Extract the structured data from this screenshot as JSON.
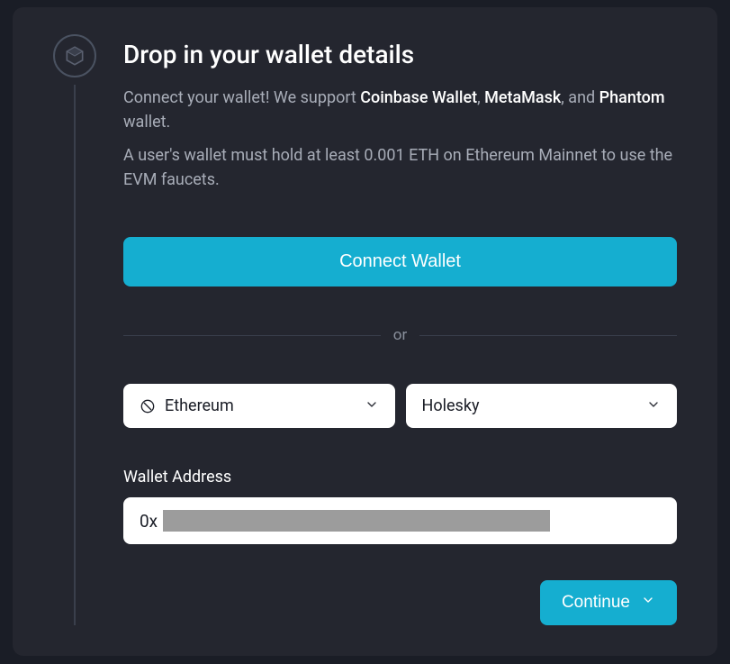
{
  "heading": "Drop in your wallet details",
  "description": {
    "intro": "Connect your wallet! We support ",
    "wallet1": "Coinbase Wallet",
    "sep1": ", ",
    "wallet2": "MetaMask",
    "sep2": ", and ",
    "wallet3": "Phantom",
    "suffix": " wallet."
  },
  "requirement": "A user's wallet must hold at least 0.001 ETH on Ethereum Mainnet to use the EVM faucets.",
  "connect_button": "Connect Wallet",
  "divider": "or",
  "blockchain_select": {
    "selected": "Ethereum"
  },
  "network_select": {
    "selected": "Holesky"
  },
  "address_field": {
    "label": "Wallet Address",
    "prefix": "0x"
  },
  "continue_button": "Continue"
}
